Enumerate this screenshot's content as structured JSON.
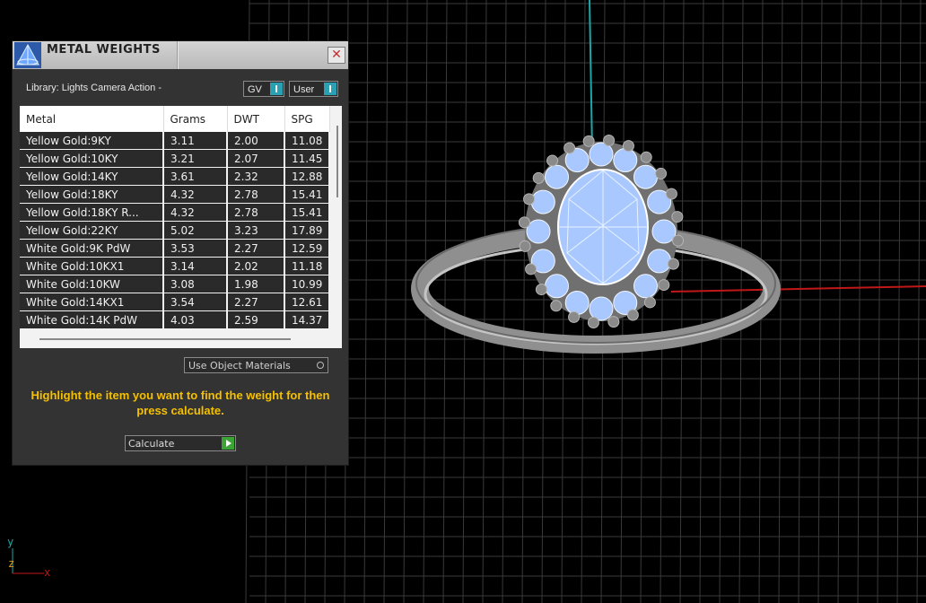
{
  "panel": {
    "title": "METAL WEIGHTS",
    "close_symbol": "✕",
    "library_label": "Library: Lights Camera Action -",
    "selector_gv": "GV",
    "selector_user": "User",
    "columns": [
      "Metal",
      "Grams",
      "DWT",
      "SPG"
    ],
    "rows": [
      [
        "Yellow Gold:9KY",
        "3.11",
        "2.00",
        "11.08"
      ],
      [
        "Yellow Gold:10KY",
        "3.21",
        "2.07",
        "11.45"
      ],
      [
        "Yellow Gold:14KY",
        "3.61",
        "2.32",
        "12.88"
      ],
      [
        "Yellow Gold:18KY",
        "4.32",
        "2.78",
        "15.41"
      ],
      [
        "Yellow Gold:18KY R...",
        "4.32",
        "2.78",
        "15.41"
      ],
      [
        "Yellow Gold:22KY",
        "5.02",
        "3.23",
        "17.89"
      ],
      [
        "White Gold:9K PdW",
        "3.53",
        "2.27",
        "12.59"
      ],
      [
        "White Gold:10KX1",
        "3.14",
        "2.02",
        "11.18"
      ],
      [
        "White Gold:10KW",
        "3.08",
        "1.98",
        "10.99"
      ],
      [
        "White Gold:14KX1",
        "3.54",
        "2.27",
        "12.61"
      ],
      [
        "White Gold:14K PdW",
        "4.03",
        "2.59",
        "14.37"
      ]
    ],
    "material_select": "Use Object Materials",
    "hint": "Highlight the item you want to find the weight for then press calculate.",
    "calculate_label": "Calculate"
  },
  "viewport": {
    "axis_y": "y",
    "axis_z": "z",
    "axis_x": "x",
    "colors": {
      "grid": "#3a3a3a",
      "axis_red": "#c01818",
      "axis_teal": "#1aa7a7",
      "metal": "#8d8d8d",
      "gem": "#a8c8ff",
      "hint_yellow": "#f5c000"
    }
  }
}
